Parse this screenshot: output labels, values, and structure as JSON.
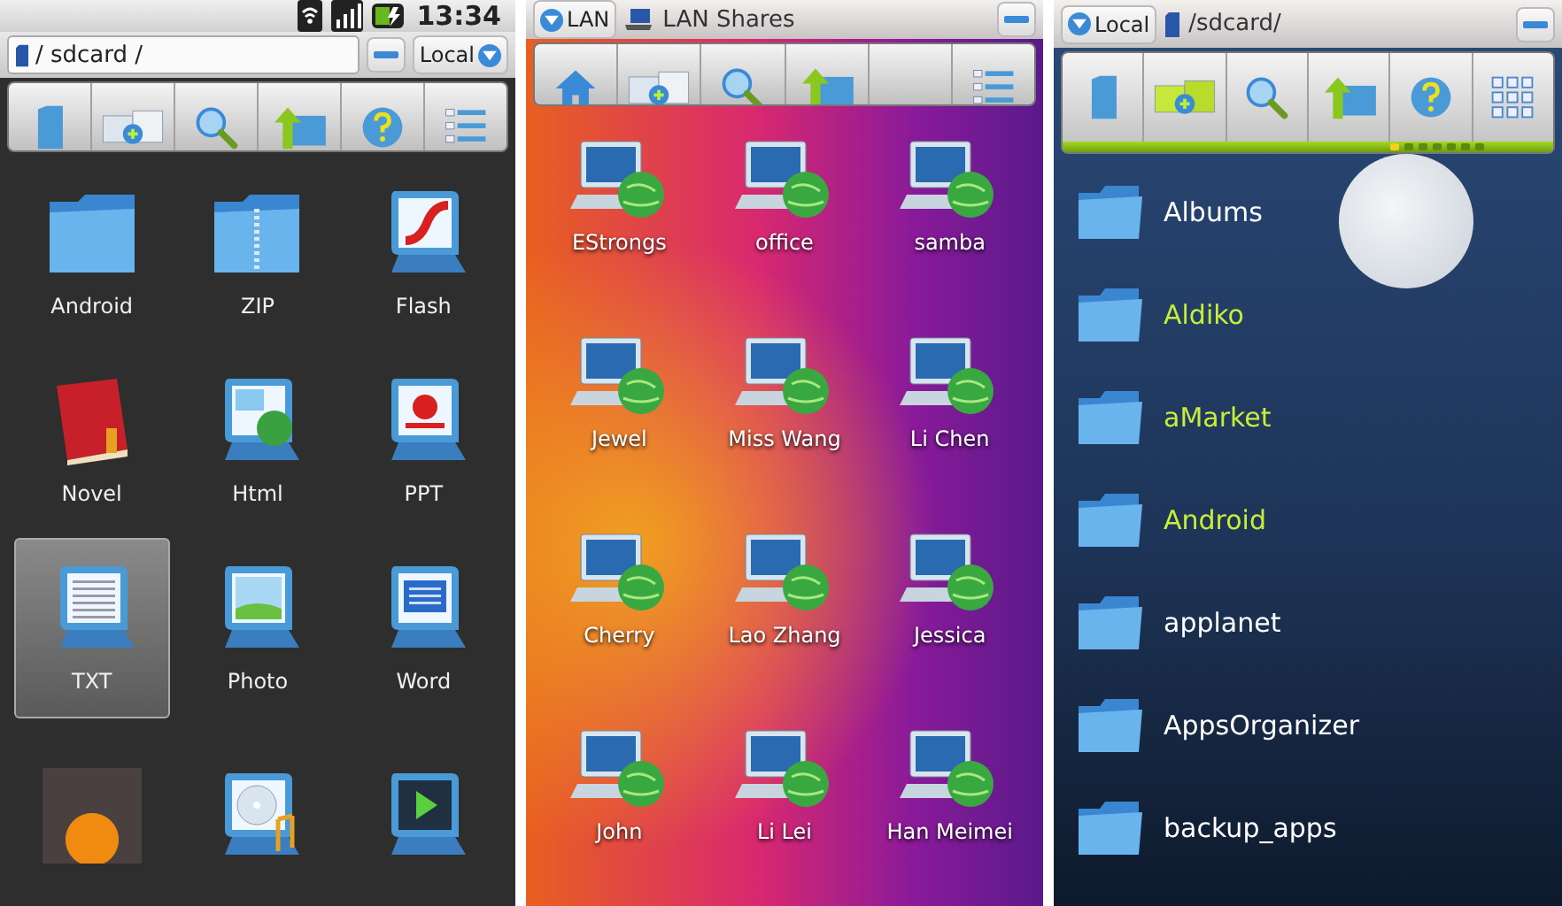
{
  "panels": [
    {
      "kind": "grid",
      "status_bar": {
        "time": "13:34"
      },
      "path": "/ sdcard /",
      "location": "Local",
      "toolbar": [
        {
          "kind": "sdcard"
        },
        {
          "kind": "new-folder"
        },
        {
          "kind": "search"
        },
        {
          "kind": "up"
        },
        {
          "kind": "help"
        },
        {
          "kind": "list"
        }
      ],
      "items": [
        {
          "kind": "folder",
          "label": "Android",
          "selected": false
        },
        {
          "kind": "zip",
          "label": "ZIP",
          "selected": false
        },
        {
          "kind": "flash",
          "label": "Flash",
          "selected": false
        },
        {
          "kind": "book",
          "label": "Novel",
          "selected": false
        },
        {
          "kind": "html",
          "label": "Html",
          "selected": false
        },
        {
          "kind": "ppt",
          "label": "PPT",
          "selected": false
        },
        {
          "kind": "txt",
          "label": "TXT",
          "selected": true
        },
        {
          "kind": "photo",
          "label": "Photo",
          "selected": false
        },
        {
          "kind": "word",
          "label": "Word",
          "selected": false
        },
        {
          "kind": "thumbnail",
          "selected": false
        },
        {
          "kind": "music",
          "selected": false
        },
        {
          "kind": "video",
          "selected": false
        }
      ]
    },
    {
      "kind": "network",
      "location": "LAN",
      "title": "LAN Shares",
      "toolbar": [
        {
          "kind": "home"
        },
        {
          "kind": "new-folder"
        },
        {
          "kind": "search"
        },
        {
          "kind": "up"
        },
        {
          "kind": "blank"
        },
        {
          "kind": "list"
        }
      ],
      "items": [
        {
          "label": "EStrongs"
        },
        {
          "label": "office"
        },
        {
          "label": "samba"
        },
        {
          "label": "Jewel"
        },
        {
          "label": "Miss Wang"
        },
        {
          "label": "Li Chen"
        },
        {
          "label": "Cherry"
        },
        {
          "label": "Lao Zhang"
        },
        {
          "label": "Jessica"
        },
        {
          "label": "John"
        },
        {
          "label": "Li Lei"
        },
        {
          "label": "Han Meimei"
        }
      ]
    },
    {
      "kind": "list",
      "location": "Local",
      "path": "/sdcard/",
      "toolbar": [
        {
          "kind": "sdcard"
        },
        {
          "kind": "new-folder-green"
        },
        {
          "kind": "search"
        },
        {
          "kind": "up"
        },
        {
          "kind": "help"
        },
        {
          "kind": "grid"
        }
      ],
      "page_dots": [
        {
          "selected": true
        },
        {
          "selected": false
        },
        {
          "selected": false
        },
        {
          "selected": false
        },
        {
          "selected": false
        },
        {
          "selected": false
        },
        {
          "selected": false
        }
      ],
      "items": [
        {
          "label": "Albums",
          "color": "#ffffff"
        },
        {
          "label": "Aldiko",
          "color": "#c6ef3a"
        },
        {
          "label": "aMarket",
          "color": "#c6ef3a"
        },
        {
          "label": "Android",
          "color": "#c6ef3a"
        },
        {
          "label": "applanet",
          "color": "#ffffff"
        },
        {
          "label": "AppsOrganizer",
          "color": "#ffffff"
        },
        {
          "label": "backup_apps",
          "color": "#ffffff"
        }
      ]
    }
  ]
}
